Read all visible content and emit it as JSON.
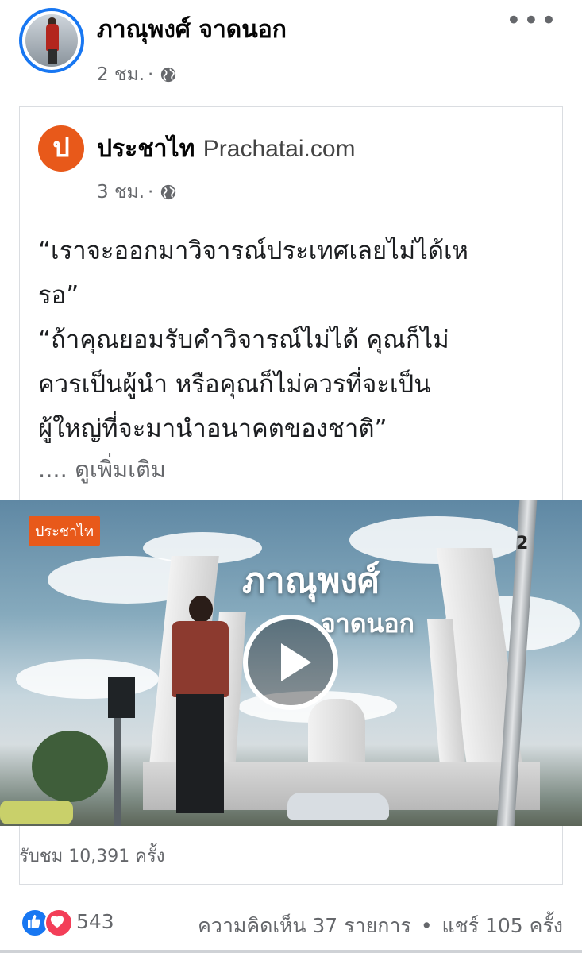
{
  "post": {
    "author": "ภาณุพงศ์ จาดนอก",
    "time": "2 ชม.",
    "dot": "·",
    "more_label": "•••"
  },
  "shared": {
    "logo_letter": "ป",
    "page_name": "ประชาไท",
    "page_sub": "Prachatai.com",
    "time": "3 ชม.",
    "dot": "·",
    "text_lines": [
      "“เราจะออกมาวิจารณ์ประเทศเลยไม่ได้เห",
      "รอ”",
      "“ถ้าคุณยอมรับคำวิจารณ์ไม่ได้ คุณก็ไม่",
      "ควรเป็นผู้นำ หรือคุณก็ไม่ควรที่จะเป็น",
      "ผู้ใหญ่ที่จะมานำอนาคตของชาติ”"
    ],
    "see_more": ".... ดูเพิ่มเติม"
  },
  "video": {
    "badge": "ประชาไท",
    "title": "ภาณุพงศ์",
    "subtitle": "จาดนอก",
    "pole_number": "2",
    "views": "รับชม 10,391 ครั้ง"
  },
  "footer": {
    "reaction_count": "543",
    "comments": "ความคิดเห็น 37 รายการ",
    "dot": "•",
    "shares": "แชร์ 105 ครั้ง"
  },
  "colors": {
    "accent": "#1877f2",
    "brand": "#e8591a",
    "love": "#f33e58",
    "muted": "#65676b"
  }
}
